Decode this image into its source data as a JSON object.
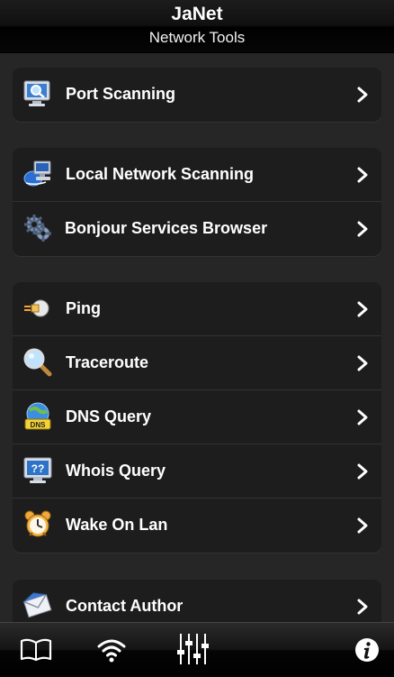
{
  "navbar": {
    "title": "JaNet",
    "subtitle": "Network Tools"
  },
  "groups": [
    {
      "items": [
        {
          "label": "Port Scanning",
          "icon": "monitor-magnifier-icon"
        }
      ]
    },
    {
      "items": [
        {
          "label": "Local Network Scanning",
          "icon": "network-computer-icon"
        },
        {
          "label": "Bonjour Services Browser",
          "icon": "gears-icon"
        }
      ]
    },
    {
      "items": [
        {
          "label": "Ping",
          "icon": "ping-bullet-icon"
        },
        {
          "label": "Traceroute",
          "icon": "magnifier-icon"
        },
        {
          "label": "DNS Query",
          "icon": "dns-globe-icon"
        },
        {
          "label": "Whois Query",
          "icon": "monitor-question-icon"
        },
        {
          "label": "Wake On Lan",
          "icon": "alarm-clock-icon"
        }
      ]
    },
    {
      "items": [
        {
          "label": "Contact Author",
          "icon": "envelope-icon"
        }
      ]
    }
  ],
  "tabbar": {
    "items": [
      {
        "icon": "book-icon"
      },
      {
        "icon": "wifi-icon"
      },
      {
        "icon": "equalizer-icon"
      },
      {
        "icon": "info-icon"
      }
    ]
  },
  "colors": {
    "background": "#262626",
    "cell": "#1d1d1d",
    "separator": "#333333",
    "text": "#ffffff"
  }
}
